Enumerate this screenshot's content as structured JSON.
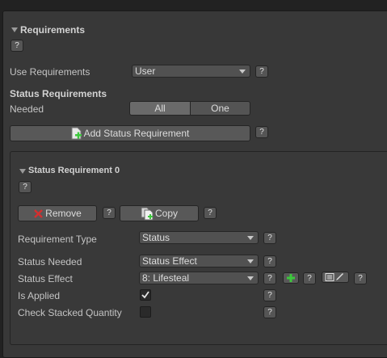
{
  "requirements": {
    "header": "Requirements",
    "help": "?",
    "use_requirements_label": "Use Requirements",
    "use_requirements_value": "User",
    "status_requirements_header": "Status Requirements",
    "needed_label": "Needed",
    "needed_options": [
      "All",
      "One"
    ],
    "needed_selected": "All",
    "add_status_requirement_label": "Add Status Requirement"
  },
  "status_requirement": {
    "header": "Status Requirement 0",
    "remove_label": "Remove",
    "copy_label": "Copy",
    "requirement_type_label": "Requirement Type",
    "requirement_type_value": "Status",
    "status_needed_label": "Status Needed",
    "status_needed_value": "Status Effect",
    "status_effect_label": "Status Effect",
    "status_effect_value": "8: Lifesteal",
    "is_applied_label": "Is Applied",
    "is_applied_checked": true,
    "check_stacked_quantity_label": "Check Stacked Quantity",
    "check_stacked_quantity_checked": false
  },
  "colors": {
    "background": "#383838",
    "toggle_selected": "#6a6a6a",
    "remove_icon": "#d23030",
    "add_icon": "#3cc83c"
  }
}
